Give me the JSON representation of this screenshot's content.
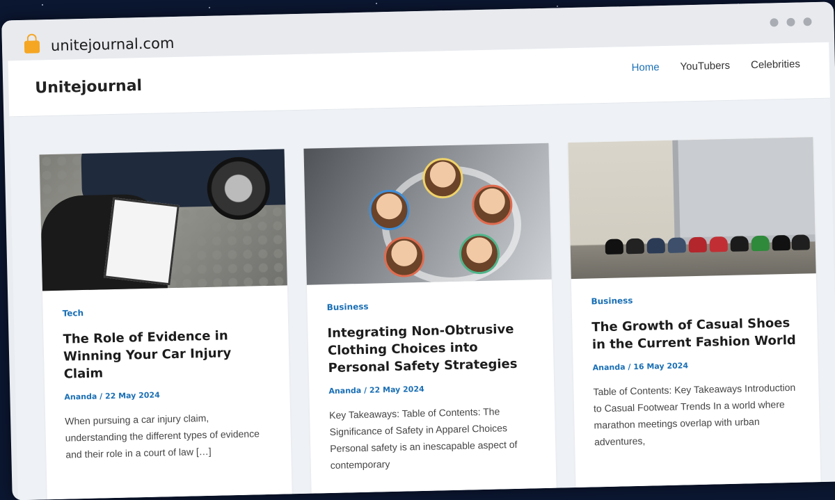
{
  "browser": {
    "url": "unitejournal.com"
  },
  "site": {
    "title": "Unitejournal",
    "nav": [
      {
        "label": "Home",
        "active": true
      },
      {
        "label": "YouTubers",
        "active": false
      },
      {
        "label": "Celebrities",
        "active": false
      }
    ]
  },
  "posts": [
    {
      "category": "Tech",
      "title": "The Role of Evidence in Winning Your Car Injury Claim",
      "meta": "Ananda / 22 May 2024",
      "excerpt": "When pursuing a car injury claim, understanding the different types of evidence and their role in a court of law […]"
    },
    {
      "category": "Business",
      "title": "Integrating Non-Obtrusive Clothing Choices into Personal Safety Strategies",
      "meta": "Ananda / 22 May 2024",
      "excerpt": "Key Takeaways: Table of Contents: The Significance of Safety in Apparel Choices Personal safety is an inescapable aspect of contemporary"
    },
    {
      "category": "Business",
      "title": "The Growth of Casual Shoes in the Current Fashion World",
      "meta": "Ananda / 16 May 2024",
      "excerpt": "Table of Contents: Key Takeaways Introduction to Casual Footwear Trends In a world where marathon meetings overlap with urban adventures,"
    }
  ],
  "colors": {
    "accent": "#1a6fb5",
    "background": "#0b1630"
  }
}
